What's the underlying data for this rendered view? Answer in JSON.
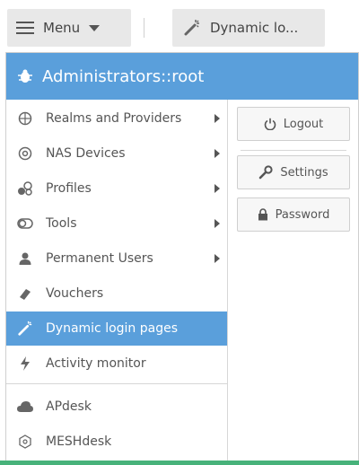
{
  "toolbar": {
    "menu_label": "Menu",
    "tab_label": "Dynamic lo..."
  },
  "panel": {
    "header_title": "Administrators::root",
    "menu_items": [
      {
        "label": "Realms and Providers",
        "icon": "realms-icon",
        "has_submenu": true
      },
      {
        "label": "NAS Devices",
        "icon": "nas-devices-icon",
        "has_submenu": true
      },
      {
        "label": "Profiles",
        "icon": "profiles-icon",
        "has_submenu": true
      },
      {
        "label": "Tools",
        "icon": "tools-icon",
        "has_submenu": true
      },
      {
        "label": "Permanent Users",
        "icon": "user-icon",
        "has_submenu": true
      },
      {
        "label": "Vouchers",
        "icon": "voucher-icon",
        "has_submenu": false
      },
      {
        "label": "Dynamic login pages",
        "icon": "magic-wand-icon",
        "has_submenu": false,
        "active": true
      },
      {
        "label": "Activity monitor",
        "icon": "activity-icon",
        "has_submenu": false
      },
      {
        "label": "APdesk",
        "icon": "cloud-icon",
        "has_submenu": false
      },
      {
        "label": "MESHdesk",
        "icon": "mesh-icon",
        "has_submenu": false
      }
    ],
    "actions": {
      "logout": "Logout",
      "settings": "Settings",
      "password": "Password"
    }
  },
  "colors": {
    "accent": "#5a9fdb",
    "toolbar_button": "#e8e8e8",
    "bottom_strip": "#47b27a"
  }
}
